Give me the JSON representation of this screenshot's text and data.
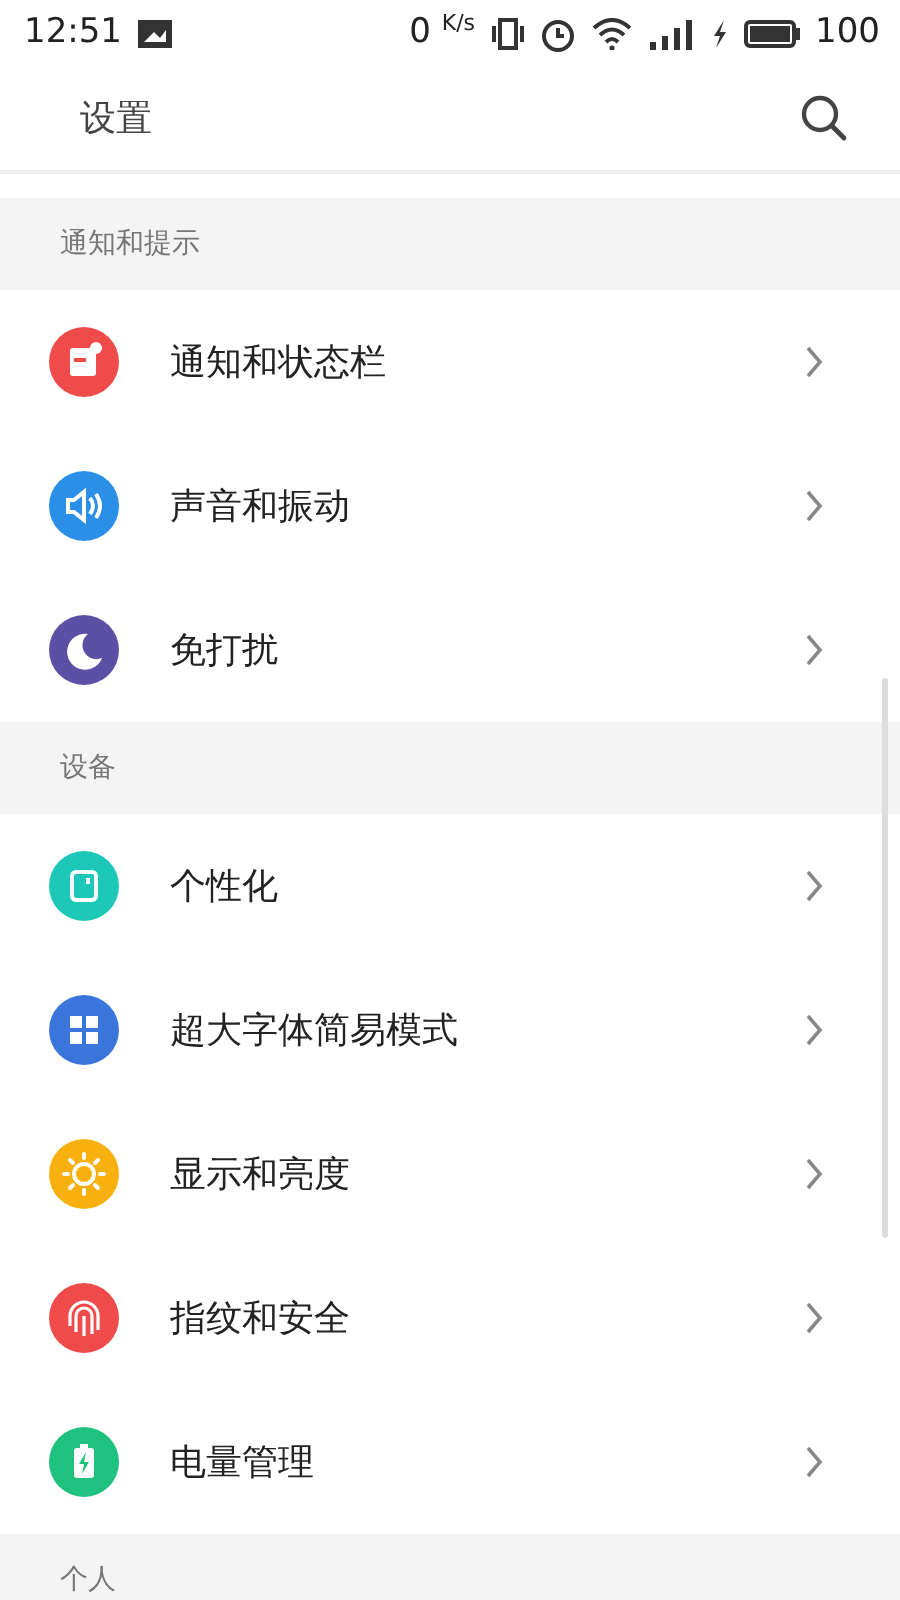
{
  "status_bar": {
    "time": "12:51",
    "net_speed": "0",
    "net_unit": "K/s",
    "battery": "100"
  },
  "header": {
    "title": "设置"
  },
  "sections": [
    {
      "title": "通知和提示",
      "items": [
        {
          "label": "通知和状态栏",
          "kind": "notice",
          "color": "#ef4b4b"
        },
        {
          "label": "声音和振动",
          "kind": "sound",
          "color": "#2b8fe8"
        },
        {
          "label": "免打扰",
          "kind": "moon",
          "color": "#5b4fa6"
        }
      ]
    },
    {
      "title": "设备",
      "items": [
        {
          "label": "个性化",
          "kind": "theme",
          "color": "#1ec8b8"
        },
        {
          "label": "超大字体简易模式",
          "kind": "grid",
          "color": "#3a75dc"
        },
        {
          "label": "显示和亮度",
          "kind": "sun",
          "color": "#f8b00f"
        },
        {
          "label": "指纹和安全",
          "kind": "finger",
          "color": "#ef4b4b"
        },
        {
          "label": "电量管理",
          "kind": "battery",
          "color": "#1fc17f"
        }
      ]
    },
    {
      "title": "个人"
    }
  ]
}
